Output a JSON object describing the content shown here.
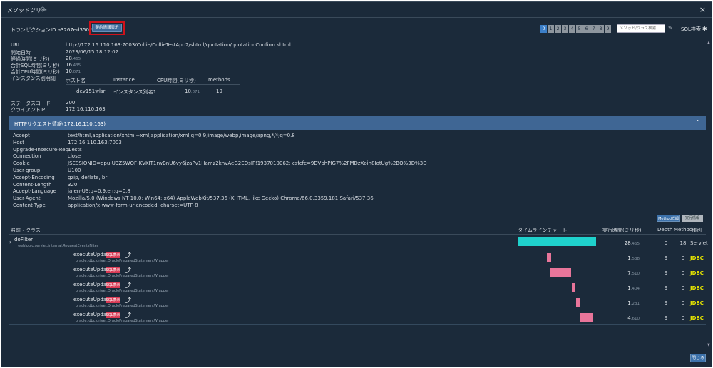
{
  "window": {
    "title": "メソッドツリー",
    "close_glyph": "×"
  },
  "toolbar": {
    "transaction_label": "トランザクションID",
    "transaction_id": "a3267ed35022a8c1",
    "contract_button": "契約情報表示",
    "pages": [
      "0",
      "1",
      "2",
      "3",
      "4",
      "5",
      "6",
      "7",
      "8",
      "9"
    ],
    "active_page": 0,
    "search_placeholder": "メソッド/クラス検索...",
    "sql_search": "SQL検索"
  },
  "summary": {
    "url_label": "URL",
    "url": "http://172.16.110.163:7003/Collie/CollieTestApp2/shtml/quotation/quotationConfirm.shtml",
    "start_label": "開始日時",
    "start": "2023/06/15 18:12:02",
    "elapsed_label": "経過時間(ミリ秒)",
    "elapsed": "28",
    "elapsed_sub": ".465",
    "sql_total_label": "合計SQL時間(ミリ秒)",
    "sql_total": "16",
    "sql_total_sub": ".435",
    "cpu_total_label": "合計CPU時間(ミリ秒)",
    "cpu_total": "10",
    "cpu_total_sub": ".071",
    "instance_label": "インスタンス別明細",
    "instance_headers": [
      "ホスト名",
      "Instance",
      "CPU時間(ミリ秒)",
      "methods"
    ],
    "instance_row": {
      "host": "dev151wlsr",
      "instance": "インスタンス別名1",
      "cpu": "10",
      "cpu_sub": ".071",
      "methods": "19"
    },
    "status_label": "ステータスコード",
    "status": "200",
    "client_label": "クライアントIP",
    "client": "172.16.110.163"
  },
  "http": {
    "title": "HTTPリクエスト情報(172.16.110.163)",
    "headers": [
      {
        "k": "Accept",
        "v": "text/html,application/xhtml+xml,application/xml;q=0.9,image/webp,image/apng,*/*;q=0.8"
      },
      {
        "k": "Host",
        "v": "172.16.110.163:7003"
      },
      {
        "k": "Upgrade-Insecure-Requests",
        "v": "1"
      },
      {
        "k": "Connection",
        "v": "close"
      },
      {
        "k": "Cookie",
        "v": "JSESSIONID=dpu-U3Z5WOF-KVKIT1rwBnU6vy6jzaPv1Hamz2knvAeG2EQsIF!1937010062; csfcfc=9DVphPIG7%2FMDzXoin8IotUg%2BQ%3D%3D"
      },
      {
        "k": "User-group",
        "v": "U100"
      },
      {
        "k": "Accept-Encoding",
        "v": "gzip, deflate, br"
      },
      {
        "k": "Content-Length",
        "v": "320"
      },
      {
        "k": "Accept-Language",
        "v": "ja,en-US;q=0.9,en;q=0.8"
      },
      {
        "k": "User-Agent",
        "v": "Mozilla/5.0 (Windows NT 10.0; Win64; x64) AppleWebKit/537.36 (KHTML, like Gecko) Chrome/66.0.3359.181 Safari/537.36"
      },
      {
        "k": "Content-Type",
        "v": "application/x-www-form-urlencoded; charset=UTF-8"
      }
    ]
  },
  "tabs": {
    "method_detail": "Method詳細",
    "exec_info": "実行情報"
  },
  "table": {
    "headers": {
      "name": "名前・クラス",
      "timeline": "タイムラインチャート",
      "exec": "実行時間(ミリ秒)",
      "depth": "Depth",
      "method": "Method",
      "kind": "種別"
    },
    "sql_badge": "SQL表示",
    "rows": [
      {
        "name": "doFilter",
        "cls": "weblogic.servlet.internal.RequestEventsFilter",
        "exec": "28",
        "exec_sub": ".465",
        "depth": "0",
        "method": "18",
        "kind": "Servlet",
        "start": 0.0,
        "len": 1.0
      },
      {
        "name": "executeUpdate",
        "cls": "oracle.jdbc.driver.OraclePreparedStatementWrapper",
        "exec": "1",
        "exec_sub": ".538",
        "depth": "9",
        "method": "0",
        "kind": "JDBC",
        "start": 0.37,
        "len": 0.054
      },
      {
        "name": "executeUpdate",
        "cls": "oracle.jdbc.driver.OraclePreparedStatementWrapper",
        "exec": "7",
        "exec_sub": ".510",
        "depth": "9",
        "method": "0",
        "kind": "JDBC",
        "start": 0.42,
        "len": 0.264
      },
      {
        "name": "executeUpdate",
        "cls": "oracle.jdbc.driver.OraclePreparedStatementWrapper",
        "exec": "1",
        "exec_sub": ".404",
        "depth": "9",
        "method": "0",
        "kind": "JDBC",
        "start": 0.69,
        "len": 0.049
      },
      {
        "name": "executeUpdate",
        "cls": "oracle.jdbc.driver.OraclePreparedStatementWrapper",
        "exec": "1",
        "exec_sub": ".231",
        "depth": "9",
        "method": "0",
        "kind": "JDBC",
        "start": 0.745,
        "len": 0.043
      },
      {
        "name": "executeUpdate",
        "cls": "oracle.jdbc.driver.OraclePreparedStatementWrapper",
        "exec": "4",
        "exec_sub": ".610",
        "depth": "9",
        "method": "0",
        "kind": "JDBC",
        "start": 0.79,
        "len": 0.162
      }
    ]
  },
  "footer": {
    "close_button": "閉じる"
  },
  "colors": {
    "accent": "#3d72ab",
    "servlet_bar": "#1fd1cc",
    "jdbc_bar": "#e8759a",
    "highlight": "#d0121b",
    "jdbc_text": "#e8e600"
  }
}
